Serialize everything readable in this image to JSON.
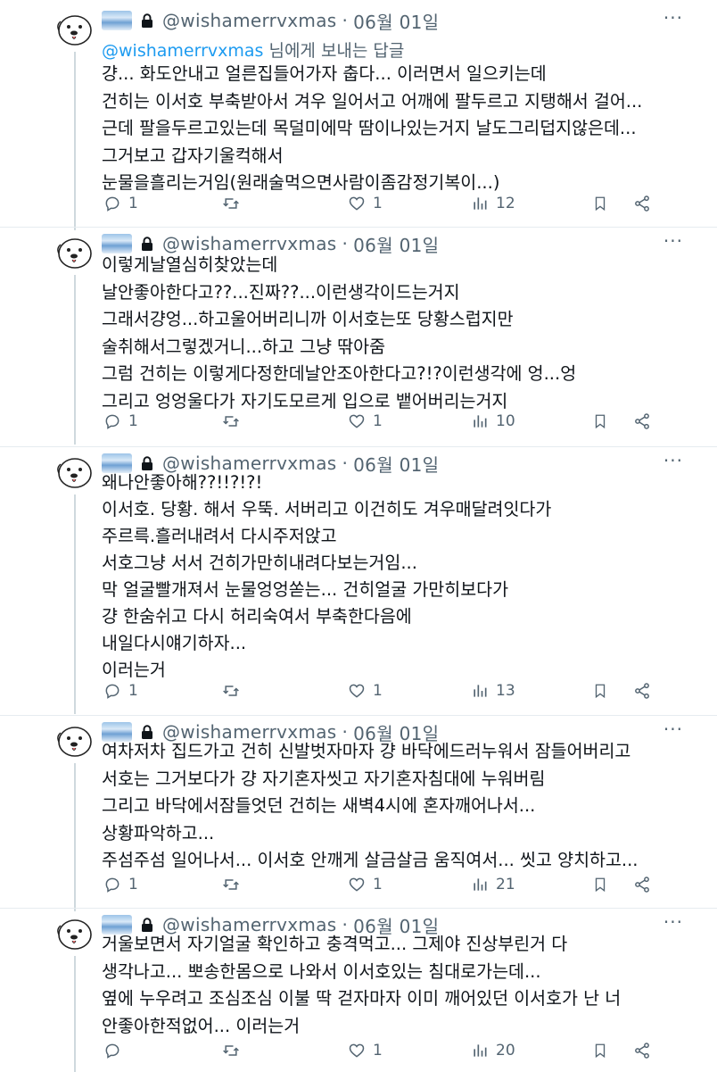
{
  "account": {
    "handle": "@wishamerrvxmas",
    "date": "06월 01일",
    "separator": "·",
    "icons": {
      "avatar": "seal-avatar",
      "banner": "sky-banner-icon",
      "protected": "lock-icon",
      "more": "more-icon"
    }
  },
  "tweets": [
    {
      "reply_to_handle": "@wishamerrvxmas",
      "reply_to_suffix": " 님에게 보내는 답글",
      "lines": [
        "걍... 화도안내고 얼른집들어가자 춥다... 이러면서 일으키는데",
        "건히는 이서호 부축받아서 겨우 일어서고 어깨에 팔두르고 지탱해서 걸어...",
        "근데 팔을두르고있는데 목덜미에막 땀이나있는거지 날도그리덥지않은데...",
        "그거보고 갑자기울컥해서",
        "눈물을흘리는거임(원래술먹으면사람이좀감정기복이...)"
      ],
      "replies": "1",
      "retweets": "",
      "likes": "1",
      "views": "12"
    },
    {
      "lines": [
        "이렇게날열심히찾았는데",
        "날안좋아한다고??...진짜??...이런생각이드는거지",
        "그래서걍엉...하고울어버리니까 이서호는또 당황스럽지만",
        "술취해서그렇겠거니...하고 그냥 딲아줌",
        "그럼 건히는 이렇게다정한데날안조아한다고?!?이런생각에 엉...엉",
        "그리고 엉엉울다가 자기도모르게 입으로 뱉어버리는거지"
      ],
      "replies": "1",
      "retweets": "",
      "likes": "1",
      "views": "10"
    },
    {
      "lines": [
        "왜나안좋아해??!!?!?!",
        "이서호. 당황. 해서 우뚝. 서버리고 이건히도 겨우매달려잇다가",
        "주르륵.흘러내려서 다시주저앉고",
        "서호그냥 서서 건히가만히내려다보는거임...",
        "막 얼굴빨개져서 눈물엉엉쏟는... 건히얼굴 가만히보다가",
        "걍 한숨쉬고 다시 허리숙여서 부축한다음에",
        "내일다시얘기하자...",
        "이러는거"
      ],
      "replies": "1",
      "retweets": "",
      "likes": "1",
      "views": "13"
    },
    {
      "lines": [
        "여차저차 집드가고 건히 신발벗자마자 걍 바닥에드러누워서 잠들어버리고",
        "서호는 그거보다가 걍 자기혼자씻고 자기혼자침대에 누워버림",
        "그리고 바닥에서잠들엇던 건히는 새벽4시에 혼자깨어나서...",
        "상황파악하고...",
        "주섬주섬 일어나서... 이서호 안깨게 살금살금 움직여서... 씻고 양치하고..."
      ],
      "replies": "1",
      "retweets": "",
      "likes": "1",
      "views": "21"
    },
    {
      "lines": [
        "거울보면서 자기얼굴 확인하고 충격먹고... 그제야 진상부린거 다",
        "생각나고... 뽀송한몸으로 나와서 이서호있는 침대로가는데...",
        "옆에 누우려고 조심조심 이불 딱 걷자마자 이미 깨어있던 이서호가 난 너",
        "안좋아한적없어... 이러는거"
      ],
      "replies": "",
      "retweets": "",
      "likes": "1",
      "views": "20"
    }
  ],
  "colors": {
    "text": "#0f1419",
    "secondary": "#536471",
    "link": "#1d9bf0",
    "divider": "#e6ecf0",
    "rail": "#cfd9de"
  }
}
